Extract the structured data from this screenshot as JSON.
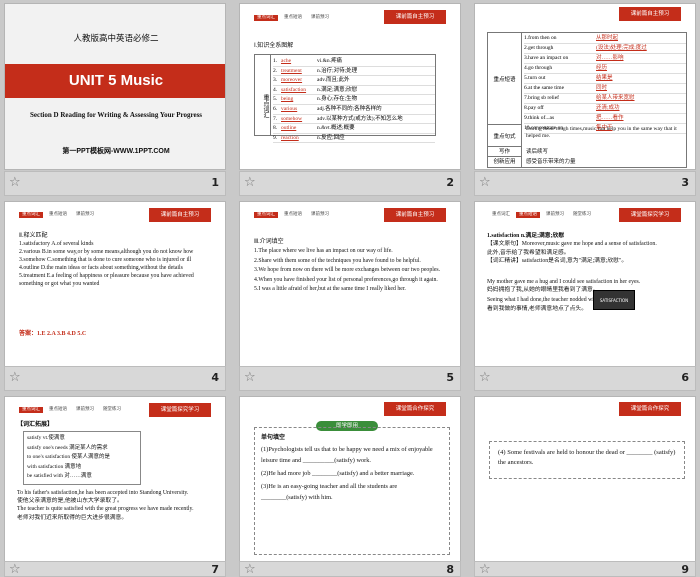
{
  "s1": {
    "sub": "人教版高中英语必修二",
    "unit": "UNIT 5   Music",
    "section": "Section D  Reading for Writing & Assessing Your Progress",
    "footer": "第一PPT模板网-WWW.1PPT.COM"
  },
  "header_tag": "课前篇自主预习",
  "header_tag2": "课堂篇探究学习",
  "header_tag3": "课堂篇合作探究",
  "tabs": [
    "重点词汇",
    "重点短语",
    "课前预习",
    "随堂练习"
  ],
  "s2": {
    "title": "Ⅰ.知识全系图解",
    "left": "重点词汇",
    "rows": [
      [
        "1.",
        "ache",
        "vi.&n.疼痛"
      ],
      [
        "2.",
        "treatment",
        "n.治疗;对待;处理"
      ],
      [
        "3.",
        "moreover",
        "adv.而且;此外"
      ],
      [
        "4.",
        "satisfaction",
        "n.满足;满意;欣慰"
      ],
      [
        "5.",
        "being",
        "n.身心;存在;生物"
      ],
      [
        "6.",
        "various",
        "adj.各种不同的;各种各样的"
      ],
      [
        "7.",
        "somehow",
        "adv.以某种方式(或方法);不知怎么地"
      ],
      [
        "8.",
        "outline",
        "n.&vt.概述;概要"
      ],
      [
        "9.",
        "reaction",
        "n.反应;回应"
      ]
    ]
  },
  "s3": {
    "left1": "重点短语",
    "rows": [
      [
        "1.from then on",
        "从那时起"
      ],
      [
        "2.get through",
        "(设法)处理;完成;度过"
      ],
      [
        "3.have an impact on",
        "对……影响"
      ],
      [
        "4.go through",
        "经历"
      ],
      [
        "5.turn out",
        "结果是"
      ],
      [
        "6.at the same time",
        "同时"
      ],
      [
        "7.bring sb relief",
        "给某人带来宽慰"
      ],
      [
        "8.pay off",
        "还清;成功"
      ],
      [
        "9.think of...as",
        "把……看作"
      ],
      [
        "10.concentrate on",
        "集中于"
      ]
    ],
    "left2": "重点句式",
    "sentence": "During those tough times,music can help you in the same way that it helped me.",
    "left3": "写作",
    "write": "读后续写",
    "left4": "创新应用",
    "apply": "感受音乐带来的力量"
  },
  "s4": {
    "title": "Ⅱ.释义匹配",
    "items": [
      "1.satisfactory   A.of several kinds",
      "2.various        B.in some way,or by some means,although you do not know how",
      "3.somehow        C.something that is done to cure someone who is injured or ill",
      "4.outline        D.the main ideas or facts about something,without the details",
      "5.treatment      E.a feeling of happiness or pleasure because you have achieved something or got what you wanted"
    ],
    "answer": "答案：1.E  2.A  3.B  4.D  5.C"
  },
  "s5": {
    "title": "Ⅲ.介词填空",
    "items": [
      "1.The place where we live has an impact  on  our way of life.",
      "2.Share  with  them some of the techniques you have found to be helpful.",
      "3.We hope from now  on  there will be more exchanges between our two peoples.",
      "4.When you have finished your list of personal preferences,go  through  it again.",
      "5.I was a little afraid of her,but  at  the same time I really liked her."
    ]
  },
  "s6": {
    "lines": [
      "1.satisfaction n.满足;满意;欣慰",
      "【课文原句】Moreover,music gave me hope and a sense of satisfaction.",
      "此外,音乐给了我希望和满足感。",
      "【词汇精讲】satisfaction是名词,意为\"满足;满意;欣慰\"。",
      "My mother gave me a hug and I could see satisfaction in her eyes.",
      "妈妈拥抱了我,从她的眼睛里我看到了满意。",
      "Seeing what I had done,the teacher nodded with satisfaction.",
      "看到我做的事情,老师满意地点了点头。"
    ],
    "img": "SATISFACTION"
  },
  "s7": {
    "title": "【词汇拓展】",
    "items": [
      "satisfy vt.使满意",
      "satisfy one's needs 满足某人的需求",
      "to one's satisfaction 使某人满意的是",
      "with satisfaction 满意地",
      "be satisfied with 对……满意"
    ],
    "ex": [
      "To his father's satisfaction,he has been accepted into Standong University.",
      "使他父亲满意的是,他被山东大学录取了。",
      "The teacher is quite satisfied with the great progress we have made recently.",
      "老师对我们近来所取得的巨大进步很满意。"
    ]
  },
  "s8": {
    "banner": "即学即用",
    "title": "单句填空",
    "items": [
      "(1)Psychologists tell us that to be happy we need a mix of enjoyable leisure time and __________(satisfy) work.",
      "(2)He had more job ________(satisfy) and a better marriage.",
      "(3)He is an easy-going teacher and all the students are ________(satisfy) with him."
    ]
  },
  "s9": {
    "item": "(4) Some festivals are held to honour the dead or ________ (satisfy) the ancestors."
  },
  "nums": [
    "1",
    "2",
    "3",
    "4",
    "5",
    "6",
    "7",
    "8",
    "9"
  ]
}
